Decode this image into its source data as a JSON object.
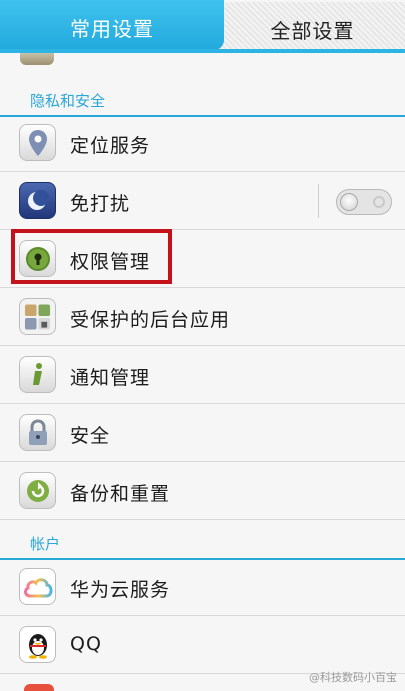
{
  "tabs": {
    "common": "常用设置",
    "all": "全部设置",
    "active": "common"
  },
  "privacy_section": {
    "title": "隐私和安全",
    "items": [
      {
        "label": "定位服务",
        "icon": "location-pin-icon"
      },
      {
        "label": "免打扰",
        "icon": "moon-icon",
        "toggle": "off"
      },
      {
        "label": "权限管理",
        "icon": "keyhole-icon",
        "highlighted": true
      },
      {
        "label": "受保护的后台应用",
        "icon": "protected-apps-icon"
      },
      {
        "label": "通知管理",
        "icon": "info-icon"
      },
      {
        "label": "安全",
        "icon": "padlock-icon"
      },
      {
        "label": "备份和重置",
        "icon": "backup-restore-icon"
      }
    ]
  },
  "account_section": {
    "title": "帐户",
    "items": [
      {
        "label": "华为云服务",
        "icon": "cloud-icon"
      },
      {
        "label": "QQ",
        "icon": "qq-penguin-icon"
      }
    ]
  },
  "colors": {
    "accent": "#2aa8d8",
    "highlight": "#c4121b"
  },
  "watermark": "@科技数码小百宝"
}
